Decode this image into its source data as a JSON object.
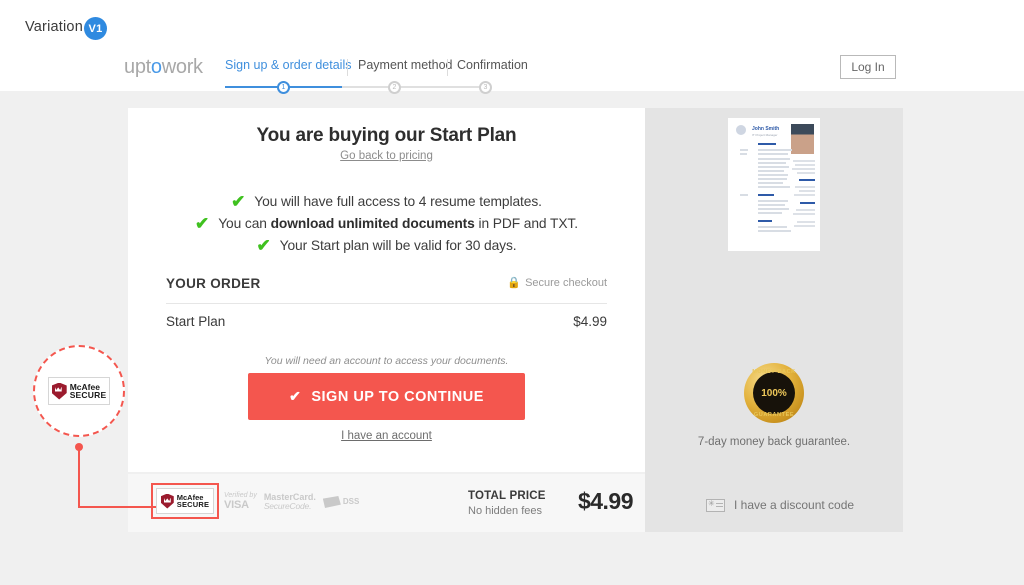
{
  "variation": {
    "label": "Variation",
    "badge": "V1"
  },
  "header": {
    "logo": {
      "pre": "upt",
      "accent": "o",
      "post": "work"
    },
    "login_label": "Log In",
    "steps": [
      {
        "label": "Sign up & order details",
        "number": "1",
        "active": true
      },
      {
        "label": "Payment method",
        "number": "2",
        "active": false
      },
      {
        "label": "Confirmation",
        "number": "3",
        "active": false
      }
    ]
  },
  "card": {
    "title": "You are buying our Start Plan",
    "back_link": "Go back to pricing",
    "benefits": [
      {
        "pre": "You will have full access to 4 resume templates.",
        "bold": "",
        "post": ""
      },
      {
        "pre": "You can ",
        "bold": "download unlimited documents",
        "post": " in PDF and TXT."
      },
      {
        "pre": "Your Start plan will be valid for 30 days.",
        "bold": "",
        "post": ""
      }
    ],
    "order_title": "YOUR ORDER",
    "secure_checkout": "Secure checkout",
    "item_name": "Start Plan",
    "item_price": "$4.99",
    "account_note": "You will need an account to access your documents.",
    "cta_label": "SIGN UP TO CONTINUE",
    "have_account": "I have an account"
  },
  "footer": {
    "mcafee": {
      "line1": "McAfee",
      "line2": "SECURE"
    },
    "badges": [
      {
        "line1": "Verified by",
        "line2": "VISA"
      },
      {
        "line1": "MasterCard.",
        "line2": "SecureCode."
      },
      {
        "line1": "pci",
        "line2": "DSS"
      }
    ],
    "total_label": "TOTAL PRICE",
    "total_sub": "No hidden fees",
    "total_value": "$4.99"
  },
  "sidebar": {
    "resume": {
      "name": "John Smith",
      "role": "IT Project Manager"
    },
    "guarantee": {
      "top": "MONEY BACK",
      "center": "100%",
      "bottom": "GUARANTEE"
    },
    "guarantee_text": "7-day money back guarantee.",
    "discount_label": "I have a discount code"
  },
  "annotation": {
    "badge": {
      "line1": "McAfee",
      "line2": "SECURE"
    }
  },
  "colors": {
    "accent_red": "#f4564e",
    "accent_blue": "#3f8fdd",
    "tick_green": "#3fc11f",
    "page_bg": "#f0f0f0",
    "sidebar_bg": "#e4e4e4"
  }
}
